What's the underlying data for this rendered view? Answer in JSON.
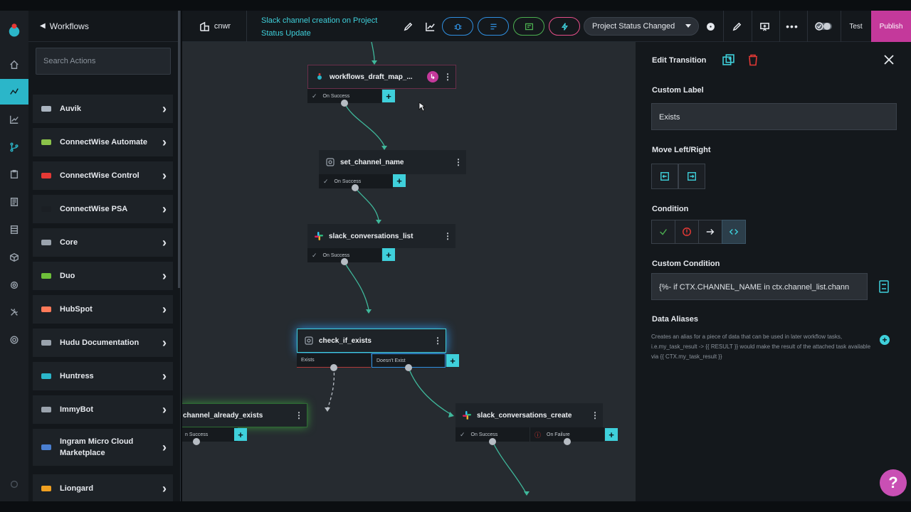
{
  "actions_panel": {
    "back_label": "Workflows",
    "search_placeholder": "Search Actions",
    "items": [
      {
        "label": "Auvik",
        "icon": "auvik-logo-icon",
        "color": "#aab4c0"
      },
      {
        "label": "ConnectWise Automate",
        "icon": "connectwise-automate-gear-icon",
        "color": "#8bc34a"
      },
      {
        "label": "ConnectWise Control",
        "icon": "connectwise-control-icon",
        "color": "#e53935"
      },
      {
        "label": "ConnectWise PSA",
        "icon": "connectwise-psa-icon",
        "color": "#1b1f24"
      },
      {
        "label": "Core",
        "icon": "core-icon",
        "color": "#9aa3ad"
      },
      {
        "label": "Duo",
        "icon": "duo-logo-icon",
        "color": "#6ebf3a"
      },
      {
        "label": "HubSpot",
        "icon": "hubspot-logo-icon",
        "color": "#ff7a59"
      },
      {
        "label": "Hudu Documentation",
        "icon": "hudu-logo-icon",
        "color": "#9aa3ad"
      },
      {
        "label": "Huntress",
        "icon": "huntress-logo-icon",
        "color": "#2bb6c9"
      },
      {
        "label": "ImmyBot",
        "icon": "immybot-logo-icon",
        "color": "#9aa3ad"
      },
      {
        "label": "Ingram Micro Cloud Marketplace",
        "icon": "ingram-micro-logo-icon",
        "color": "#4a7fd0"
      },
      {
        "label": "Liongard",
        "icon": "liongard-logo-icon",
        "color": "#f0a020"
      }
    ]
  },
  "toolbar": {
    "org": "cnwr",
    "workflow_title": "Slack channel creation on Project Status Update",
    "trigger": "Project Status Changed",
    "test_label": "Test",
    "publish_label": "Publish"
  },
  "canvas": {
    "nodes": [
      {
        "label": "workflows_draft_map_...",
        "out1": "On Success"
      },
      {
        "label": "set_channel_name",
        "out1": "On Success"
      },
      {
        "label": "slack_conversations_list",
        "out1": "On Success"
      },
      {
        "label": "check_if_exists",
        "out1": "Exists",
        "out2": "Doesn't Exist"
      },
      {
        "label": "channel_already_exists",
        "out1": "n Success"
      },
      {
        "label": "slack_conversations_create",
        "out1": "On Success",
        "out2": "On Failure"
      }
    ]
  },
  "edit_panel": {
    "title": "Edit Transition",
    "custom_label_heading": "Custom Label",
    "custom_label_value": "Exists",
    "move_heading": "Move Left/Right",
    "condition_heading": "Condition",
    "custom_condition_heading": "Custom Condition",
    "custom_condition_value": "{%- if CTX.CHANNEL_NAME in ctx.channel_list.chann",
    "data_aliases_heading": "Data Aliases",
    "data_aliases_help": "Creates an alias for a piece of data that can be used in later workflow tasks, i.e.my_task_result -> {{ RESULT }} would make the result of the attached task available via {{ CTX.my_task_result }}"
  },
  "help_label": "?"
}
